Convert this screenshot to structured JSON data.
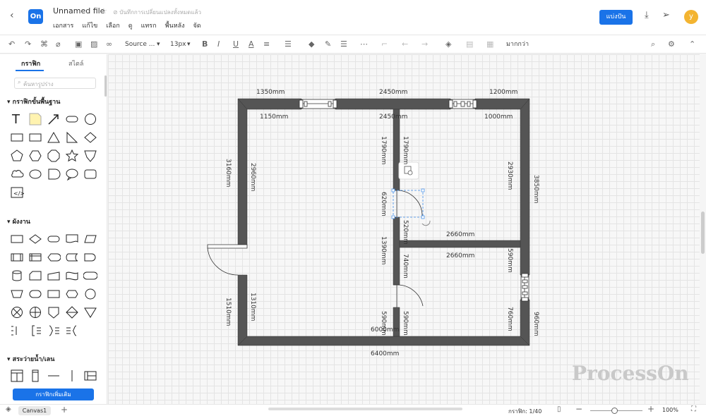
{
  "header": {
    "back_icon": "‹",
    "logo_text": "On",
    "file_title": "Unnamed file",
    "star_icon": "☆",
    "save_status": "⊘ บันทึกการเปลี่ยนแปลงทั้งหมดแล้ว",
    "menu": [
      "เอกสาร",
      "แก้ไข",
      "เลือก",
      "ดู",
      "แทรก",
      "พื้นหลัง",
      "จัด"
    ],
    "share_label": "แบ่งปัน",
    "avatar_letter": "y",
    "accent_color": "#1a73e8"
  },
  "toolbar": {
    "font_name": "Source ...",
    "font_size": "13px",
    "more_label": "มากกว่า"
  },
  "sidebar": {
    "tabs": [
      "กราฟิก",
      "สไตล์"
    ],
    "search_placeholder": "ค้นหารูปร่าง",
    "sections": [
      "กราฟิกขั้นพื้นฐาน",
      "ผังงาน",
      "สระว่ายน้ำ/เลน"
    ],
    "more_shapes_label": "กราฟิกเพิ่มเติม"
  },
  "floorplan": {
    "top_dims": [
      "1350mm",
      "2450mm",
      "1200mm"
    ],
    "inner_top_dims": [
      "1150mm",
      "2450mm",
      "1000mm"
    ],
    "left_dims": [
      "3160mm",
      "1510mm"
    ],
    "left_inner_dims": [
      "2960mm",
      "1310mm"
    ],
    "right_dims": [
      "3850mm",
      "960mm"
    ],
    "right_inner_dims": [
      "2930mm",
      "590mm",
      "760mm"
    ],
    "mid_wall_dims": [
      "1790mm",
      "1790mm",
      "620mm",
      "520mm",
      "1390mm",
      "740mm",
      "590mm",
      "590mm"
    ],
    "partition_dims": [
      "2660mm",
      "2660mm"
    ],
    "bottom_inner_dim": "6000mm",
    "bottom_dim": "6400mm"
  },
  "statusbar": {
    "canvas_tab": "Canvas1",
    "page_label": "กราฟิก: 1/40",
    "zoom": "100%"
  },
  "watermark": "ProcessOn"
}
